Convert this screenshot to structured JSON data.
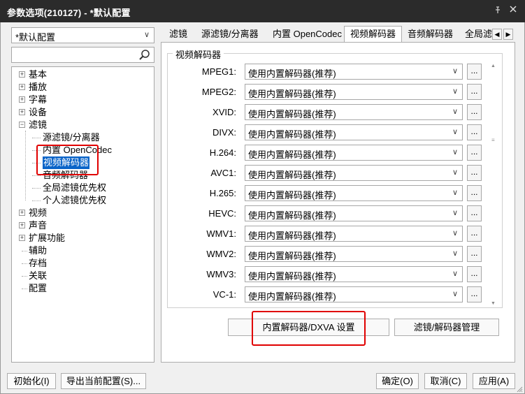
{
  "window": {
    "title": "参数选项(210127) - *默认配置",
    "pin_icon": "pin-icon",
    "close_icon": "close-icon"
  },
  "profile": {
    "selected": "*默认配置"
  },
  "search": {
    "placeholder": ""
  },
  "tree": {
    "items": [
      {
        "label": "基本",
        "expandable": true
      },
      {
        "label": "播放",
        "expandable": true
      },
      {
        "label": "字幕",
        "expandable": true
      },
      {
        "label": "设备",
        "expandable": true
      },
      {
        "label": "滤镜",
        "expandable": true,
        "expanded": true
      },
      {
        "label": "源滤镜/分离器",
        "child": true
      },
      {
        "label": "内置 OpenCodec",
        "child": true
      },
      {
        "label": "视频解码器",
        "child": true,
        "selected": true
      },
      {
        "label": "音频解码器",
        "child": true
      },
      {
        "label": "全局滤镜优先权",
        "child": true
      },
      {
        "label": "个人滤镜优先权",
        "child": true
      },
      {
        "label": "视频",
        "expandable": true
      },
      {
        "label": "声音",
        "expandable": true
      },
      {
        "label": "扩展功能",
        "expandable": true
      },
      {
        "label": "辅助"
      },
      {
        "label": "存档"
      },
      {
        "label": "关联"
      },
      {
        "label": "配置"
      }
    ]
  },
  "tabs": [
    "滤镜",
    "源滤镜/分离器",
    "内置 OpenCodec",
    "视频解码器",
    "音频解码器",
    "全局滤"
  ],
  "active_tab": 3,
  "group": {
    "title": "视频解码器"
  },
  "decoders": [
    {
      "label": "MPEG1:",
      "value": "使用内置解码器(推荐)"
    },
    {
      "label": "MPEG2:",
      "value": "使用内置解码器(推荐)"
    },
    {
      "label": "XVID:",
      "value": "使用内置解码器(推荐)"
    },
    {
      "label": "DIVX:",
      "value": "使用内置解码器(推荐)"
    },
    {
      "label": "H.264:",
      "value": "使用内置解码器(推荐)"
    },
    {
      "label": "AVC1:",
      "value": "使用内置解码器(推荐)"
    },
    {
      "label": "H.265:",
      "value": "使用内置解码器(推荐)"
    },
    {
      "label": "HEVC:",
      "value": "使用内置解码器(推荐)"
    },
    {
      "label": "WMV1:",
      "value": "使用内置解码器(推荐)"
    },
    {
      "label": "WMV2:",
      "value": "使用内置解码器(推荐)"
    },
    {
      "label": "WMV3:",
      "value": "使用内置解码器(推荐)"
    },
    {
      "label": "VC-1:",
      "value": "使用内置解码器(推荐)"
    }
  ],
  "dots_label": "...",
  "buttons": {
    "dxva": "内置解码器/DXVA 设置",
    "manage": "滤镜/解码器管理",
    "init": "初始化(I)",
    "export": "导出当前配置(S)...",
    "ok": "确定(O)",
    "cancel": "取消(C)",
    "apply": "应用(A)"
  },
  "colors": {
    "titlebar": "#2b2b2b",
    "selection": "#0a64c8",
    "highlight": "#e00000"
  }
}
